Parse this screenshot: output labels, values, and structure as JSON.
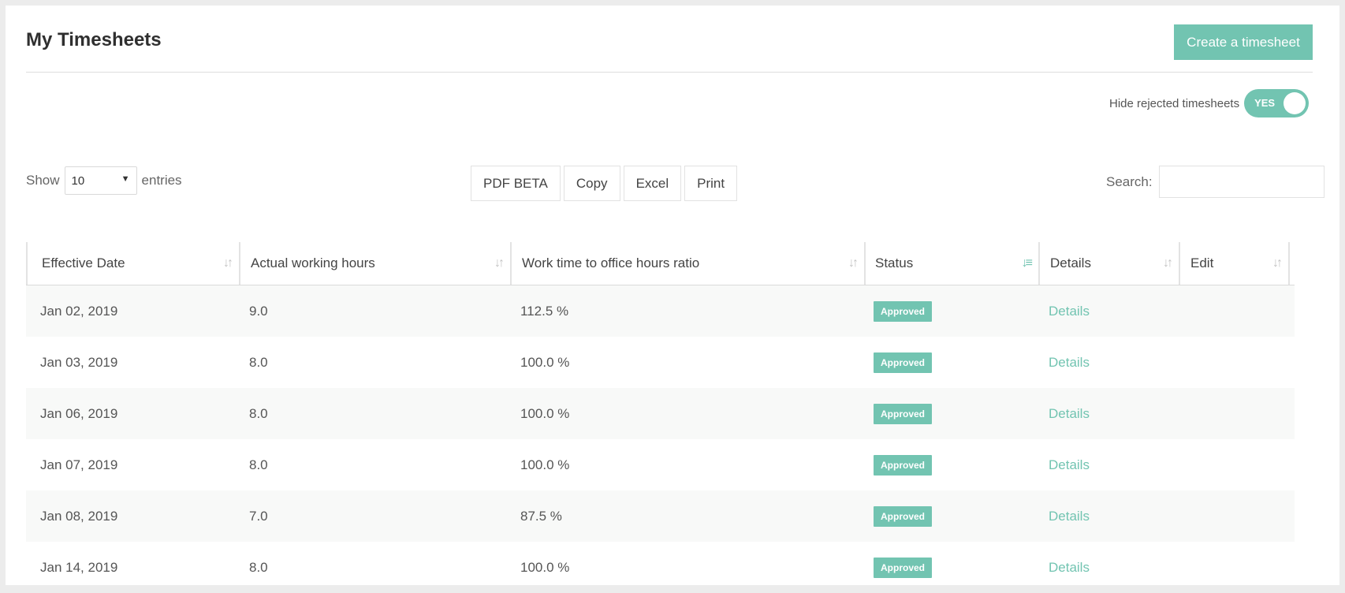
{
  "page": {
    "title": "My Timesheets"
  },
  "create_button": "Create a timesheet",
  "toggle": {
    "label": "Hide rejected timesheets",
    "value": "YES"
  },
  "length": {
    "show": "Show",
    "value": "10",
    "entries": "entries"
  },
  "export_buttons": [
    "PDF BETA",
    "Copy",
    "Excel",
    "Print"
  ],
  "search": {
    "label": "Search:",
    "value": ""
  },
  "columns": [
    "Effective Date",
    "Actual working hours",
    "Work time to office hours ratio",
    "Status",
    "Details",
    "Edit"
  ],
  "rows": [
    {
      "date": "Jan 02, 2019",
      "hours": "9.0",
      "ratio": "112.5 %",
      "status": "Approved",
      "details": "Details"
    },
    {
      "date": "Jan 03, 2019",
      "hours": "8.0",
      "ratio": "100.0 %",
      "status": "Approved",
      "details": "Details"
    },
    {
      "date": "Jan 06, 2019",
      "hours": "8.0",
      "ratio": "100.0 %",
      "status": "Approved",
      "details": "Details"
    },
    {
      "date": "Jan 07, 2019",
      "hours": "8.0",
      "ratio": "100.0 %",
      "status": "Approved",
      "details": "Details"
    },
    {
      "date": "Jan 08, 2019",
      "hours": "7.0",
      "ratio": "87.5 %",
      "status": "Approved",
      "details": "Details"
    },
    {
      "date": "Jan 14, 2019",
      "hours": "8.0",
      "ratio": "100.0 %",
      "status": "Approved",
      "details": "Details"
    }
  ],
  "colors": {
    "accent": "#72c4b1",
    "background": "#ececec"
  },
  "icons": {
    "sort": "sort-icon",
    "sort_active": "sort-active-icon",
    "dropdown": "caret-down-icon"
  }
}
